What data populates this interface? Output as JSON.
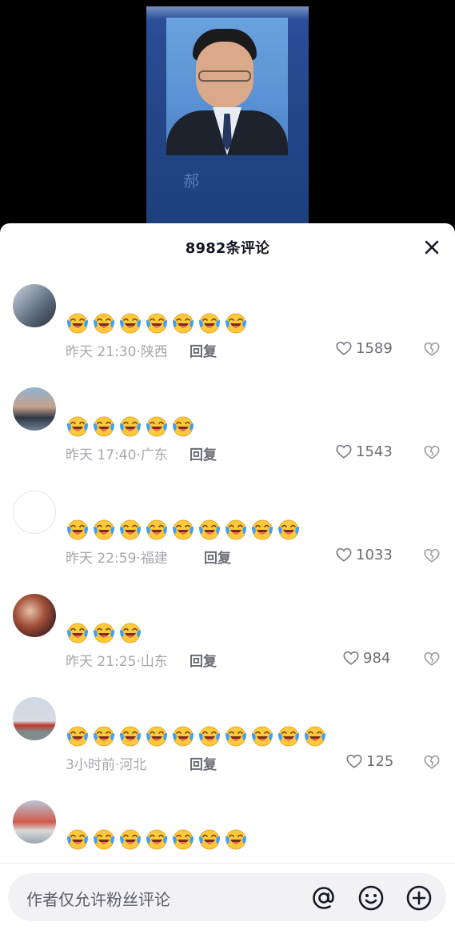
{
  "video": {
    "watermark": "郝"
  },
  "header": {
    "title": "8982条评论"
  },
  "comments": [
    {
      "emoji_count": 7,
      "time": "昨天 21:30",
      "location": "陕西",
      "reply": "回复",
      "likes": "1589"
    },
    {
      "emoji_count": 5,
      "time": "昨天 17:40",
      "location": "广东",
      "reply": "回复",
      "likes": "1543"
    },
    {
      "emoji_count": 9,
      "time": "昨天 22:59",
      "location": "福建",
      "reply": "回复",
      "likes": "1033"
    },
    {
      "emoji_count": 3,
      "time": "昨天 21:25",
      "location": "山东",
      "reply": "回复",
      "likes": "984"
    },
    {
      "emoji_count": 10,
      "time": "3小时前",
      "location": "河北",
      "reply": "回复",
      "likes": "125"
    },
    {
      "emoji_count": 7,
      "time": "",
      "location": "",
      "reply": "",
      "likes": ""
    }
  ],
  "separator": "·",
  "input": {
    "placeholder": "作者仅允许粉丝评论"
  },
  "icons": {
    "close": "close-icon",
    "like": "heart-outline-icon",
    "dislike": "broken-heart-icon",
    "mention": "at-icon",
    "emoji": "smiley-icon",
    "add": "plus-circle-icon",
    "comment_emoji": "laughing-crying-emoji-icon"
  },
  "colors": {
    "sheet_bg": "#ffffff",
    "text_primary": "#161823",
    "text_secondary": "#a6a7ad",
    "emoji_yellow": "#ffc93c",
    "tear_blue": "#3aa0ff"
  }
}
